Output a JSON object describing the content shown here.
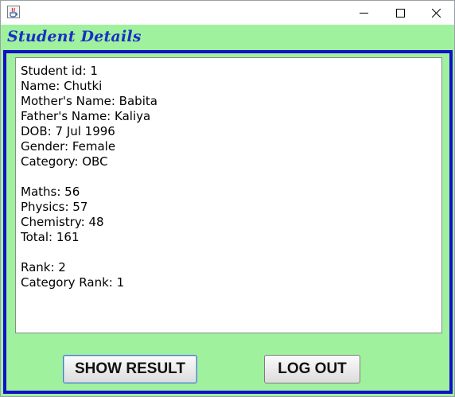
{
  "window": {
    "heading": "Student Details"
  },
  "icons": {
    "app": "java-app-icon",
    "minimize": "minimize-icon",
    "maximize": "maximize-icon",
    "close": "close-icon"
  },
  "colors": {
    "background": "#a0f19e",
    "heading": "#1b2fc4",
    "panel_border": "#1010c8"
  },
  "details": {
    "lines": [
      "Student id: 1",
      "Name: Chutki",
      "Mother's Name: Babita",
      "Father's Name: Kaliya",
      "DOB: 7 Jul 1996",
      "Gender: Female",
      "Category: OBC",
      "",
      "Maths: 56",
      "Physics: 57",
      "Chemistry: 48",
      "Total: 161",
      "",
      "Rank: 2",
      "Category Rank: 1"
    ]
  },
  "buttons": {
    "show_result": "SHOW RESULT",
    "log_out": "LOG OUT"
  }
}
